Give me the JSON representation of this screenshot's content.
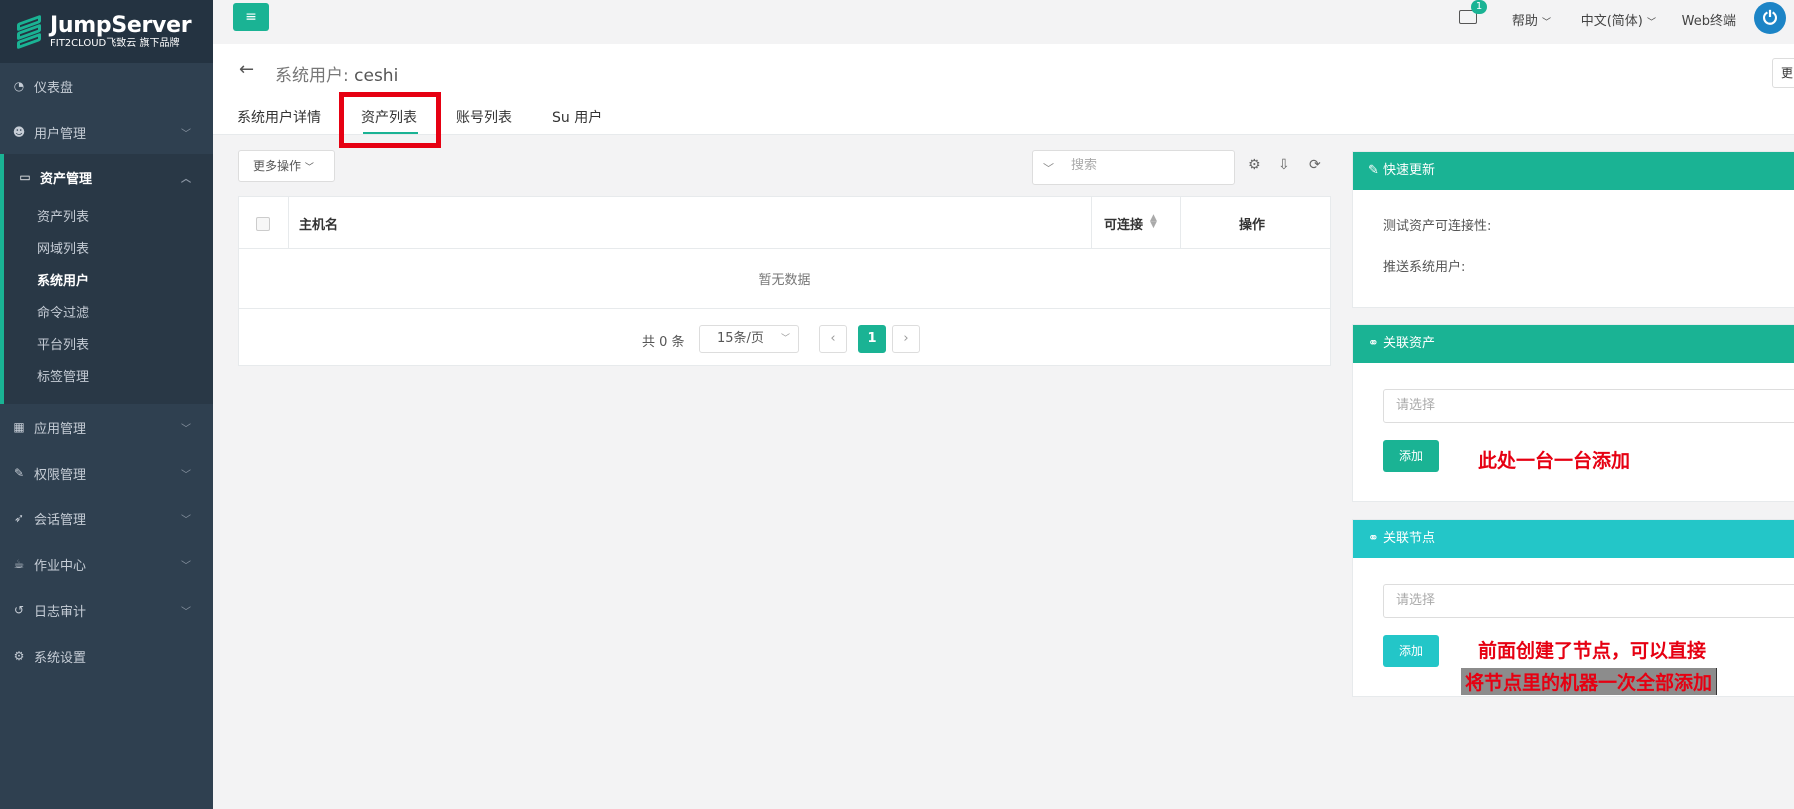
{
  "logo": {
    "title": "JumpServer",
    "subtitle": "FIT2CLOUD飞致云 旗下品牌"
  },
  "sidebar": {
    "items": [
      {
        "label": "仪表盘",
        "icon": "dashboard-icon"
      },
      {
        "label": "用户管理",
        "icon": "users-icon"
      },
      {
        "label": "资产管理",
        "icon": "inbox-icon"
      },
      {
        "label": "应用管理",
        "icon": "grid-icon"
      },
      {
        "label": "权限管理",
        "icon": "edit-icon"
      },
      {
        "label": "会话管理",
        "icon": "rocket-icon"
      },
      {
        "label": "作业中心",
        "icon": "coffee-icon"
      },
      {
        "label": "日志审计",
        "icon": "history-icon"
      },
      {
        "label": "系统设置",
        "icon": "cogs-icon"
      }
    ],
    "submenu": [
      "资产列表",
      "网域列表",
      "系统用户",
      "命令过滤",
      "平台列表",
      "标签管理"
    ]
  },
  "topbar": {
    "mail_count": "1",
    "help": "帮助",
    "language": "中文(简体)",
    "web_terminal": "Web终端"
  },
  "header": {
    "title_prefix": "系统用户:",
    "title_name": "ceshi",
    "right_button": "更",
    "tabs": [
      "系统用户详情",
      "资产列表",
      "账号列表",
      "Su 用户"
    ]
  },
  "toolbar": {
    "more_actions": "更多操作",
    "search_placeholder": "搜索"
  },
  "table": {
    "columns": [
      "主机名",
      "可连接",
      "操作"
    ],
    "empty_text": "暂无数据",
    "total": "共 0 条",
    "page_size": "15条/页",
    "current_page": "1"
  },
  "quick_update": {
    "title": "快速更新",
    "test_label": "测试资产可连接性:",
    "push_label": "推送系统用户:"
  },
  "related_assets": {
    "title": "关联资产",
    "placeholder": "请选择",
    "add": "添加",
    "annotation": "此处一台一台添加"
  },
  "related_nodes": {
    "title": "关联节点",
    "placeholder": "请选择",
    "add": "添加",
    "annotation_line1": "前面创建了节点，可以直接",
    "annotation_line2": "将节点里的机器一次全部添加"
  },
  "colors": {
    "sidebar": "#2f4050",
    "primary": "#1ab394",
    "info": "#23c6c8",
    "highlight": "#e60012"
  }
}
